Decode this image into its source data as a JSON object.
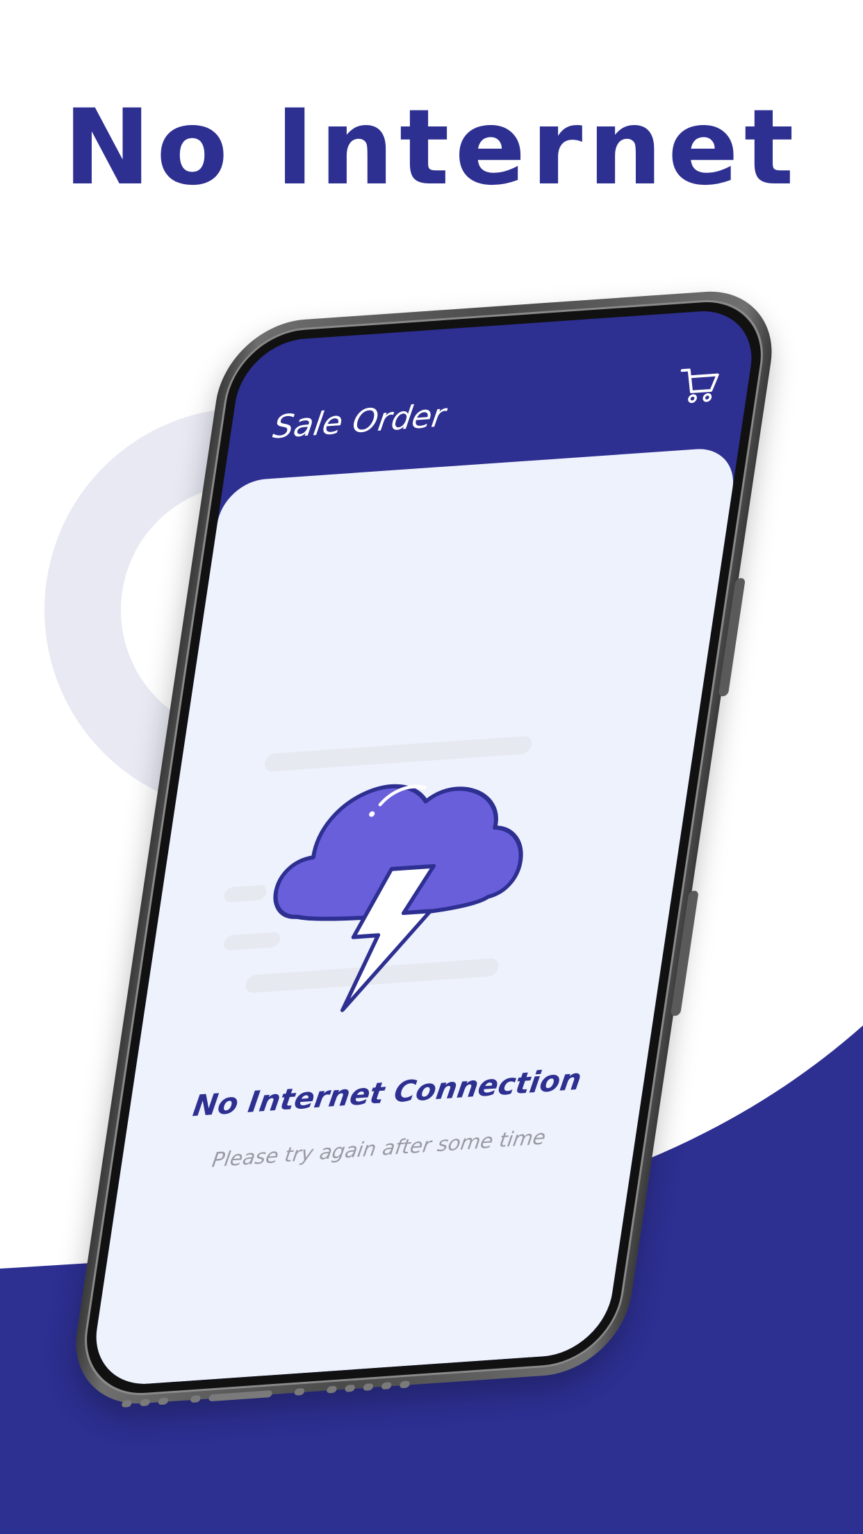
{
  "headline": "No Internet",
  "app": {
    "title": "Sale Order",
    "cart_icon": "cart-icon"
  },
  "message": {
    "title": "No Internet Connection",
    "subtitle": "Please try again after some time"
  },
  "illustration": {
    "icon": "cloud-lightning-icon"
  },
  "colors": {
    "brand": "#2d2f91",
    "cloud": "#6a5fdb",
    "screen_bg": "#eef2fc",
    "ring": "#e8e9f3",
    "subtitle": "#9a9aa4"
  }
}
